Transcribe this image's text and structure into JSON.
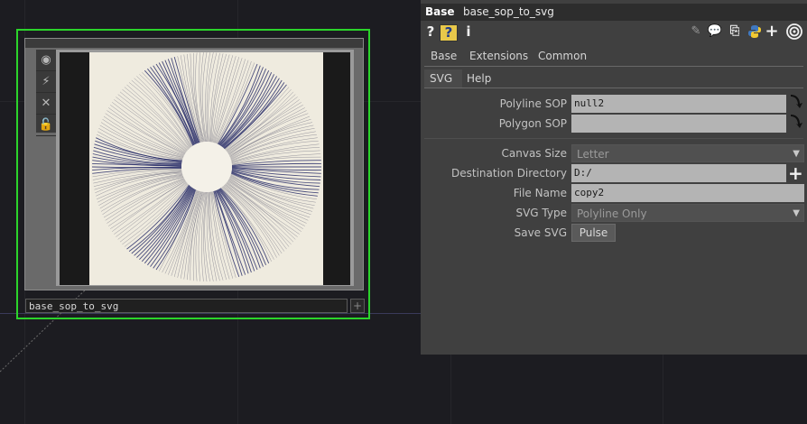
{
  "network": {
    "node": {
      "name": "base_sop_to_svg",
      "add_symbol": "+",
      "tool_icons": [
        "viewer-icon",
        "wire-icon",
        "bypass-icon",
        "lock-icon"
      ]
    }
  },
  "panel": {
    "op_type": "Base",
    "op_name": "base_sop_to_svg",
    "icons": [
      "help-icon",
      "operator-help-icon",
      "info-icon",
      "edit-icon",
      "comment-icon",
      "clone-icon",
      "python-icon",
      "add-icon",
      "target-icon"
    ],
    "help_symbol": "?",
    "info_symbol": "i",
    "add_symbol": "+",
    "page_tabs": [
      "Base",
      "Extensions",
      "Common"
    ],
    "custom_tabs": [
      "SVG",
      "Help"
    ],
    "params": {
      "polyline_sop": {
        "label": "Polyline SOP",
        "value": "null2"
      },
      "polygon_sop": {
        "label": "Polygon SOP",
        "value": ""
      },
      "canvas_size": {
        "label": "Canvas Size",
        "value": "Letter"
      },
      "destination_directory": {
        "label": "Destination Directory",
        "value": "D:/"
      },
      "file_name": {
        "label": "File Name",
        "value": "copy2"
      },
      "svg_type": {
        "label": "SVG Type",
        "value": "Polyline Only"
      },
      "save_svg": {
        "label": "Save SVG",
        "button": "Pulse"
      }
    }
  },
  "colors": {
    "background": "#1c1c21",
    "node_selected": "#2bd42b",
    "panel": "#404040",
    "field": "#b4b4b4"
  }
}
